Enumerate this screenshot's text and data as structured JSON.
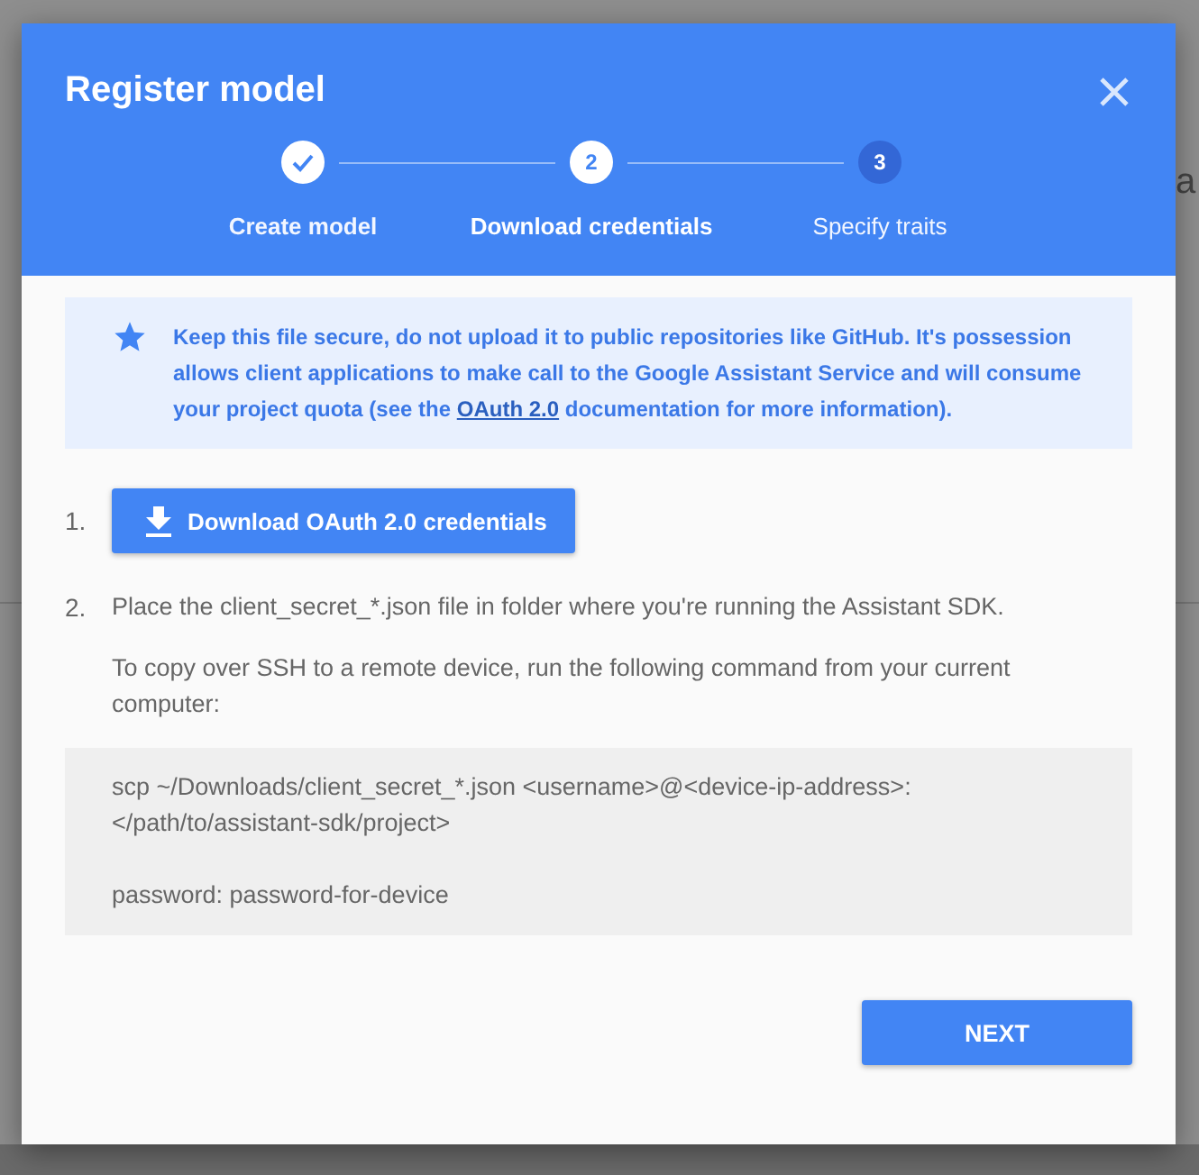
{
  "background": {
    "page_text": "a"
  },
  "dialog": {
    "title": "Register model",
    "steps": [
      {
        "label": "Create model",
        "done": true,
        "selected": false
      },
      {
        "label": "Download credentials",
        "number": "2",
        "done": false,
        "selected": true
      },
      {
        "label": "Specify traits",
        "number": "3",
        "done": false,
        "selected": false
      }
    ],
    "notice": {
      "text_before": "Keep this file secure, do not upload it to public repositories like GitHub. It's possession allows client applications to make call to the Google Assistant Service and will consume your project quota (see the",
      "link": "OAuth 2.0",
      "text_after": "documentation for more information)."
    },
    "instructions": [
      {
        "number": "1.",
        "kind": "button",
        "button": "Download OAuth 2.0 credentials"
      },
      {
        "number": "2.",
        "kind": "text",
        "paragraphs": [
          "Place the client_secret_*.json file in folder where you're running the Assistant SDK.",
          "To copy over SSH to a remote device, run the following command from your current computer:"
        ],
        "code": [
          {
            "lines": [
              "scp ~/Downloads/client_secret_*.json <username>@<device-ip-address>:",
              "</path/to/assistant-sdk/project>"
            ]
          },
          {
            "lines": [
              "password: password-for-device"
            ]
          }
        ]
      }
    ],
    "next_button": "NEXT"
  }
}
